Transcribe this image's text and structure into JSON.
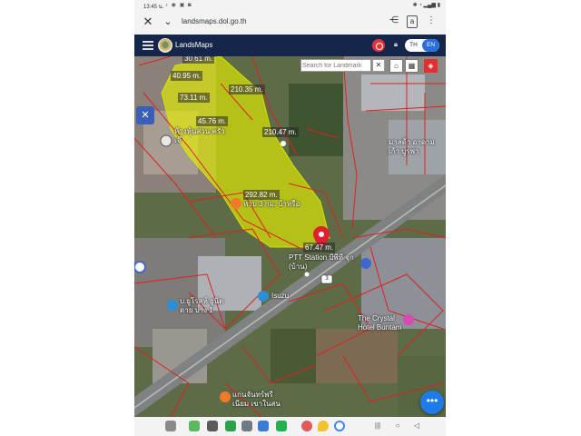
{
  "status_bar": {
    "time": "13:45 น.",
    "left_icons": "♪ ◉ ▣ ◙",
    "right_icons": "✱ ◔ ▂▄▆ ▮"
  },
  "browser": {
    "close_icon": "close-icon",
    "chevron_icon": "chevron-down-icon",
    "url": "landsmaps.dol.go.th",
    "share_icon": "share-icon",
    "translate_icon": "translate-icon",
    "menu_icon": "more-vertical-icon"
  },
  "app_header": {
    "title": "LandsMaps",
    "lang_th": "TH",
    "lang_en": "EN",
    "accent_color": "#15264a",
    "active_lang_color": "#2a6fdb"
  },
  "map": {
    "search_placeholder": "Search for Landmark",
    "clear_label": "✕",
    "parcel_highlight_color": "#e6f000",
    "parcel_line_color": "#e02020",
    "distance_labels": [
      "30.61 m.",
      "40.95 m.",
      "73.11 m.",
      "210.35 m.",
      "45.76 m.",
      "210.47 m.",
      "292.82 m.",
      "67.47 m."
    ],
    "poi_labels": [
      "ห้างหุ้นส่วน ครัวเจ๊",
      "มาสด้า อาดาม เก้า บูรพา",
      "หาบ 3 กม. บ้าหรือ",
      "PTT Station บีพีที จุก (บ้าน)",
      "Isuzu",
      "บ.ยูโรสห์ ยูนิตดาย บาง 1",
      "The Crystal Hotel Buntam",
      "แก่นจันทร์พรี เนียม เขาในสน"
    ],
    "highway_shield": "3",
    "fab_label": "•••"
  },
  "nav_bar": {
    "recent_icon": "|||",
    "home_icon": "○",
    "back_icon": "◁"
  }
}
